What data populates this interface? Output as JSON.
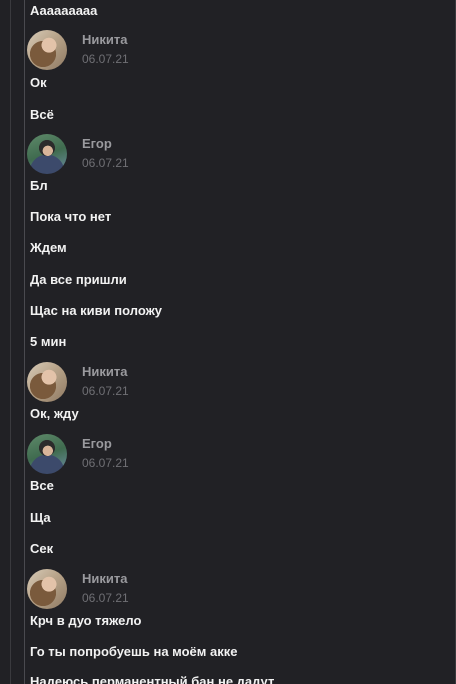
{
  "messages": {
    "m0": "Ааааааааа",
    "m1": "Ок",
    "m2": "Всё",
    "m3": "Бл",
    "m4": "Пока что нет",
    "m5": "Ждем",
    "m6": "Да все пришли",
    "m7": "Щас на киви положу",
    "m8": "5 мин",
    "m9": "Ок, жду",
    "m10": "Все",
    "m11": "Ща",
    "m12": "Сек",
    "m13": "Крч в дуо тяжело",
    "m14": "Го ты попробуешь на моём акке",
    "m15": "Надеюсь перманентный бан не дадут"
  },
  "headers": {
    "h1": {
      "author": "Никита",
      "date": "06.07.21",
      "avatar_icon": "user-avatar-nikita"
    },
    "h2": {
      "author": "Егор",
      "date": "06.07.21",
      "avatar_icon": "user-avatar-egor"
    },
    "h3": {
      "author": "Никита",
      "date": "06.07.21",
      "avatar_icon": "user-avatar-nikita"
    },
    "h4": {
      "author": "Егор",
      "date": "06.07.21",
      "avatar_icon": "user-avatar-egor"
    },
    "h5": {
      "author": "Никита",
      "date": "06.07.21",
      "avatar_icon": "user-avatar-nikita"
    }
  },
  "colors": {
    "background": "#212125",
    "message_text": "#f2f2f2",
    "author_text": "#9a9a9e",
    "date_text": "#6f6f74"
  }
}
